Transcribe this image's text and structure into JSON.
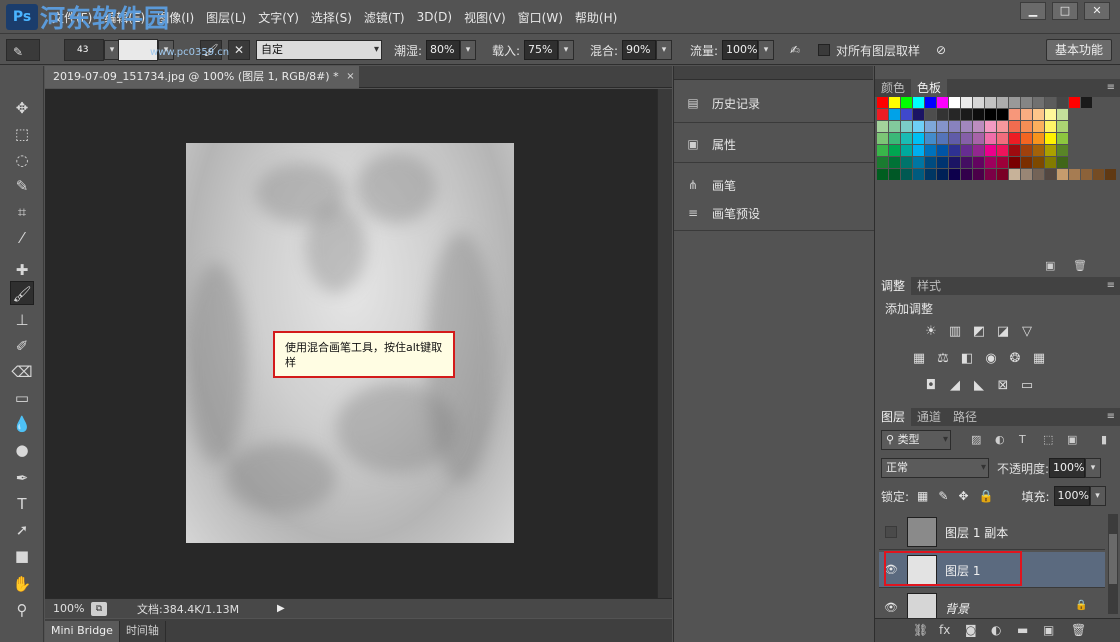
{
  "app": {
    "logo": "Ps",
    "watermark_text": "河东软件园",
    "watermark_url": "www.pc0359.cn"
  },
  "menu": [
    "文件(F)",
    "编辑(E)",
    "图像(I)",
    "图层(L)",
    "文字(Y)",
    "选择(S)",
    "滤镜(T)",
    "3D(D)",
    "视图(V)",
    "窗口(W)",
    "帮助(H)"
  ],
  "window_controls": {
    "minimize": "▁",
    "maximize": "□",
    "close": "✕"
  },
  "options": {
    "brush_size": "43",
    "mode_label": "自定",
    "wet_label": "潮湿:",
    "wet_value": "80%",
    "load_label": "载入:",
    "load_value": "75%",
    "mix_label": "混合:",
    "mix_value": "90%",
    "flow_label": "流量:",
    "flow_value": "100%",
    "sample_all_label": "对所有图层取样",
    "workspace": "基本功能"
  },
  "document": {
    "tab_title": "2019-07-09_151734.jpg @ 100% (图层 1, RGB/8#) *",
    "close": "×",
    "callout_text": "使用混合画笔工具，按住alt键取样"
  },
  "status": {
    "zoom": "100%",
    "doc_info": "文档:384.4K/1.13M"
  },
  "bottom_tabs": [
    "Mini Bridge",
    "时间轴"
  ],
  "mid_panel": {
    "history": "历史记录",
    "properties": "属性",
    "brush": "画笔",
    "brush_presets": "画笔预设"
  },
  "color_panel": {
    "tabs": [
      "颜色",
      "色板"
    ],
    "active_tab": "色板",
    "swatch_rows": [
      [
        "#ff0000",
        "#ffff00",
        "#00ff00",
        "#00ffff",
        "#0000ff",
        "#ff00ff",
        "#ffffff",
        "#ebebeb",
        "#d6d6d6",
        "#c2c2c2",
        "#adadad",
        "#999999",
        "#858585",
        "#707070",
        "#5c5c5c",
        "#474747",
        "#ff0000",
        "#1a1a1a"
      ],
      [
        "#ed1c24",
        "#00a2e8",
        "#3f48cc",
        "#1b1464",
        "#4d4d4d",
        "#333333",
        "#262626",
        "#1a1a1a",
        "#0d0d0d",
        "#000000",
        "#000000",
        "#f7977a",
        "#f9ad81",
        "#fdc68a",
        "#fff79a",
        "#c4df9b"
      ],
      [
        "#a3d39c",
        "#82ca9d",
        "#7bcdc8",
        "#6ecff6",
        "#7ea7d8",
        "#8493ca",
        "#8882be",
        "#a187be",
        "#bc8dbf",
        "#f49ac2",
        "#f6989d",
        "#f26c4f",
        "#f68e55",
        "#fbaf5d",
        "#fff467",
        "#acd372"
      ],
      [
        "#7cc576",
        "#3bb878",
        "#1abbb4",
        "#00bff3",
        "#438ccb",
        "#5574b9",
        "#605ca8",
        "#855fa8",
        "#a763a8",
        "#f06eaa",
        "#f26d7d",
        "#ed1c24",
        "#f26522",
        "#f7941d",
        "#fff200",
        "#8dc73f"
      ],
      [
        "#39b54a",
        "#00a651",
        "#00a99d",
        "#00aeef",
        "#0072bc",
        "#0054a6",
        "#2e3192",
        "#662d91",
        "#92278f",
        "#ec008c",
        "#ed145b",
        "#9e0b0f",
        "#a0410d",
        "#a36209",
        "#aba000",
        "#598527"
      ],
      [
        "#1a7b30",
        "#007236",
        "#00746b",
        "#0076a3",
        "#004b80",
        "#003471",
        "#1b1464",
        "#440e62",
        "#630460",
        "#9e005d",
        "#9e0039",
        "#790000",
        "#7b2e00",
        "#7d4900",
        "#827b00",
        "#406618"
      ],
      [
        "#005e20",
        "#005826",
        "#005952",
        "#005b7f",
        "#003663",
        "#002157",
        "#0d004c",
        "#32004b",
        "#4b0049",
        "#7b0046",
        "#7a0026",
        "#c7b299",
        "#998675",
        "#736357",
        "#534741",
        "#c69c6d",
        "#a67c52",
        "#8c6239",
        "#754c24",
        "#603913"
      ]
    ]
  },
  "adjust_panel": {
    "tabs": [
      "调整",
      "样式"
    ],
    "title": "添加调整",
    "icons_row1": [
      "brightness-icon",
      "levels-icon",
      "curves-icon",
      "exposure-icon",
      "vibrance-icon"
    ],
    "icons_row2": [
      "hue-sat-icon",
      "color-balance-icon",
      "black-white-icon",
      "photo-filter-icon",
      "channel-mixer-icon",
      "color-lookup-icon"
    ],
    "icons_row3": [
      "invert-icon",
      "posterize-icon",
      "threshold-icon",
      "selective-color-icon",
      "gradient-map-icon"
    ]
  },
  "layers_panel": {
    "tabs": [
      "图层",
      "通道",
      "路径"
    ],
    "filter_label": "类型",
    "blend_mode": "正常",
    "opacity_label": "不透明度:",
    "opacity_value": "100%",
    "lock_label": "锁定:",
    "fill_label": "填充:",
    "fill_value": "100%",
    "layers": [
      {
        "name": "图层 1 副本",
        "visible": false,
        "selected": false
      },
      {
        "name": "图层 1",
        "visible": true,
        "selected": true
      },
      {
        "name": "背景",
        "visible": true,
        "selected": false,
        "locked": true
      }
    ]
  },
  "colors": {
    "accent_red": "#d31a1a",
    "selected_layer": "#5b6a7f"
  }
}
